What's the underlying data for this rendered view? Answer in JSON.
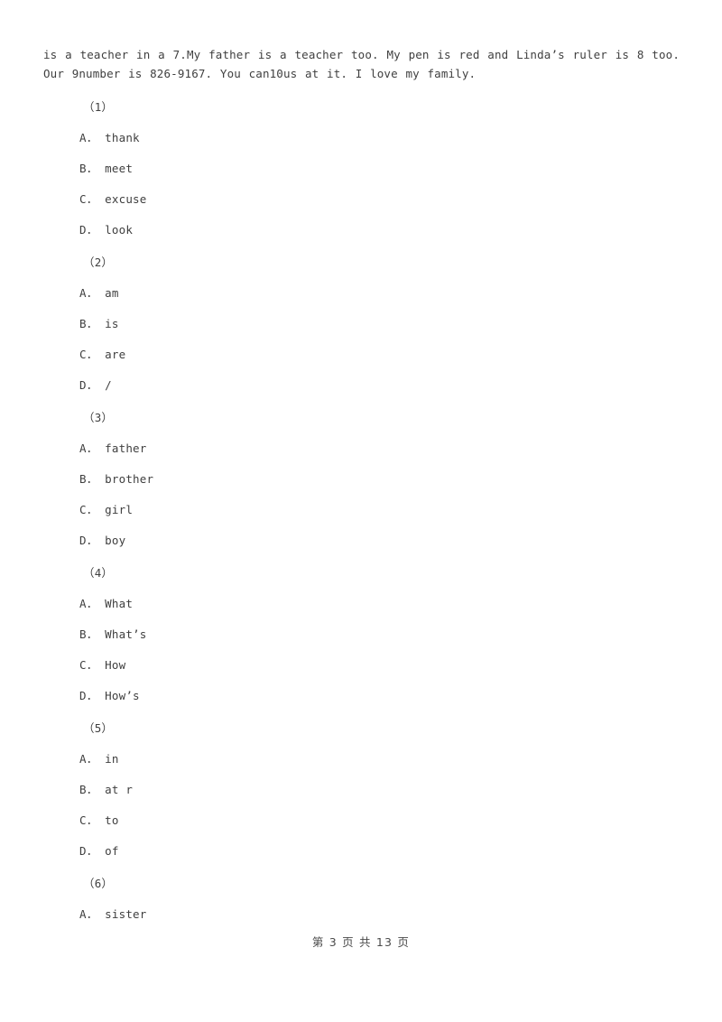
{
  "document": {
    "passage_text": "is a teacher in a 7.My father is a teacher too. My pen is red and Linda’s ruler is 8 too. Our 9number is 826-9167. You can10us at it. I love my family.",
    "questions": [
      {
        "number": "（1）",
        "options": [
          "A． thank",
          "B． meet",
          "C． excuse",
          "D． look"
        ]
      },
      {
        "number": "（2）",
        "options": [
          "A． am",
          "B． is",
          "C． are",
          "D． /"
        ]
      },
      {
        "number": "（3）",
        "options": [
          "A． father",
          "B． brother",
          "C． girl",
          "D． boy"
        ]
      },
      {
        "number": "（4）",
        "options": [
          "A． What",
          "B． What’s",
          "C． How",
          "D． How’s"
        ]
      },
      {
        "number": "（5）",
        "options": [
          "A． in",
          "B． at r",
          "C． to",
          "D． of"
        ]
      },
      {
        "number": "（6）",
        "options": [
          "A． sister"
        ]
      }
    ],
    "footer": "第 3 页 共 13 页"
  }
}
